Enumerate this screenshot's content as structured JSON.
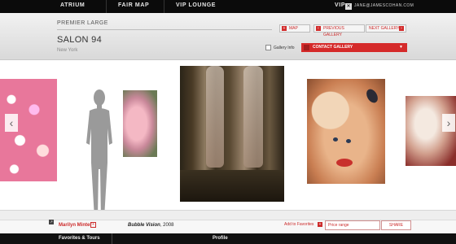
{
  "topnav": {
    "items": [
      "ATRIUM",
      "FAIR MAP",
      "VIP LOUNGE"
    ],
    "vip_label": "VIP",
    "vip_icon": "x-icon",
    "user_email": "JANE@JAMESCOHAN.COM"
  },
  "gallery": {
    "section": "PREMIER LARGE",
    "name": "SALON 94",
    "city": "New York",
    "map_label": "MAP",
    "previous_label": "PREVIOUS GALLERY",
    "next_label": "NEXT GALLERY",
    "gallery_info_label": "Gallery Info",
    "contact_label": "CONTACT GALLERY"
  },
  "artwork": {
    "artist": "Marilyn Minter",
    "title": "Bubble Vision",
    "year": ", 2008",
    "add_favorites": "Add to Favorites",
    "price_placeholder": "Price range",
    "share_label": "SHARE"
  },
  "bottombar": {
    "tabs": [
      "Favorites & Tours",
      "Profile"
    ]
  },
  "colors": {
    "accent": "#d52a2a",
    "topbar": "#0b0b0b"
  }
}
